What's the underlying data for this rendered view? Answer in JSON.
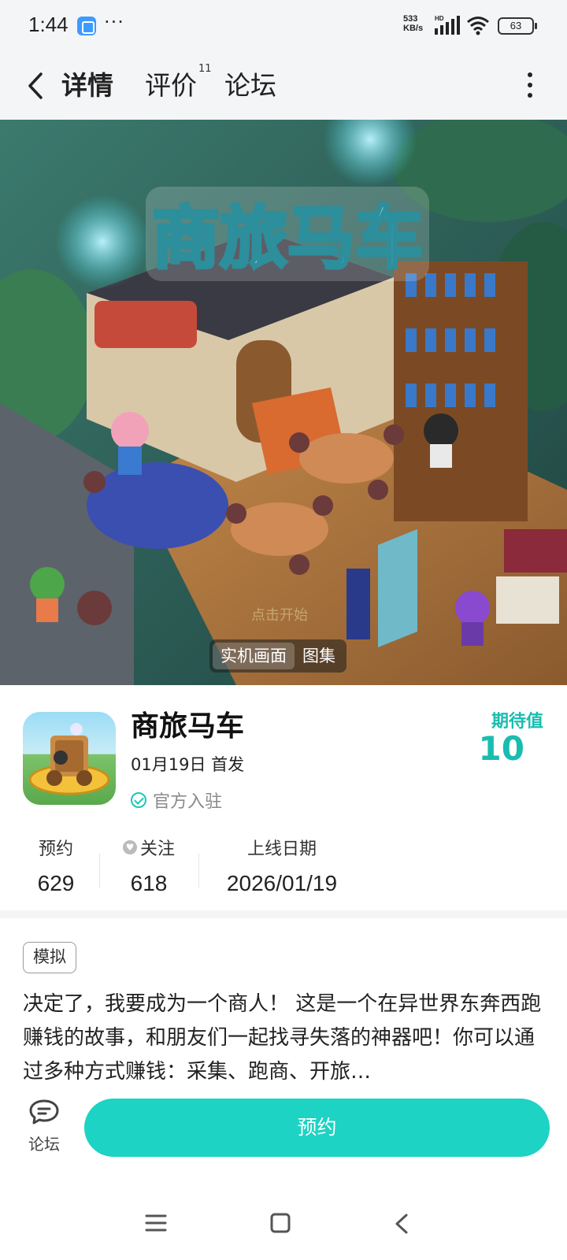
{
  "status_bar": {
    "time": "1:44",
    "more": "···",
    "net_speed_value": "533",
    "net_speed_unit": "KB/s",
    "signal_badge": "HD",
    "battery": "63"
  },
  "nav": {
    "tabs": [
      {
        "label": "详情",
        "active": true
      },
      {
        "label": "评价",
        "badge": "11"
      },
      {
        "label": "论坛"
      }
    ]
  },
  "hero": {
    "logo_text": "商旅马车",
    "hint": "点击开始",
    "tabs": [
      {
        "label": "实机画面",
        "active": true
      },
      {
        "label": "图集"
      }
    ]
  },
  "game": {
    "title": "商旅马车",
    "release": "01月19日 首发",
    "official": "官方入驻",
    "expect_label": "期待值",
    "expect_value": "10"
  },
  "stats": [
    {
      "label": "预约",
      "value": "629"
    },
    {
      "label": "关注",
      "value": "618"
    },
    {
      "label": "上线日期",
      "value": "2026/01/19"
    }
  ],
  "tag": "模拟",
  "description": "决定了，我要成为一个商人！ 这是一个在异世界东奔西跑赚钱的故事，和朋友们一起找寻失落的神器吧！你可以通过多种方式赚钱：采集、跑商、开旅…",
  "actions": {
    "forum_label": "论坛",
    "reserve_label": "预约"
  },
  "colors": {
    "accent": "#1dd3c4",
    "expect": "#19bdb0",
    "background": "#f4f5f7"
  }
}
